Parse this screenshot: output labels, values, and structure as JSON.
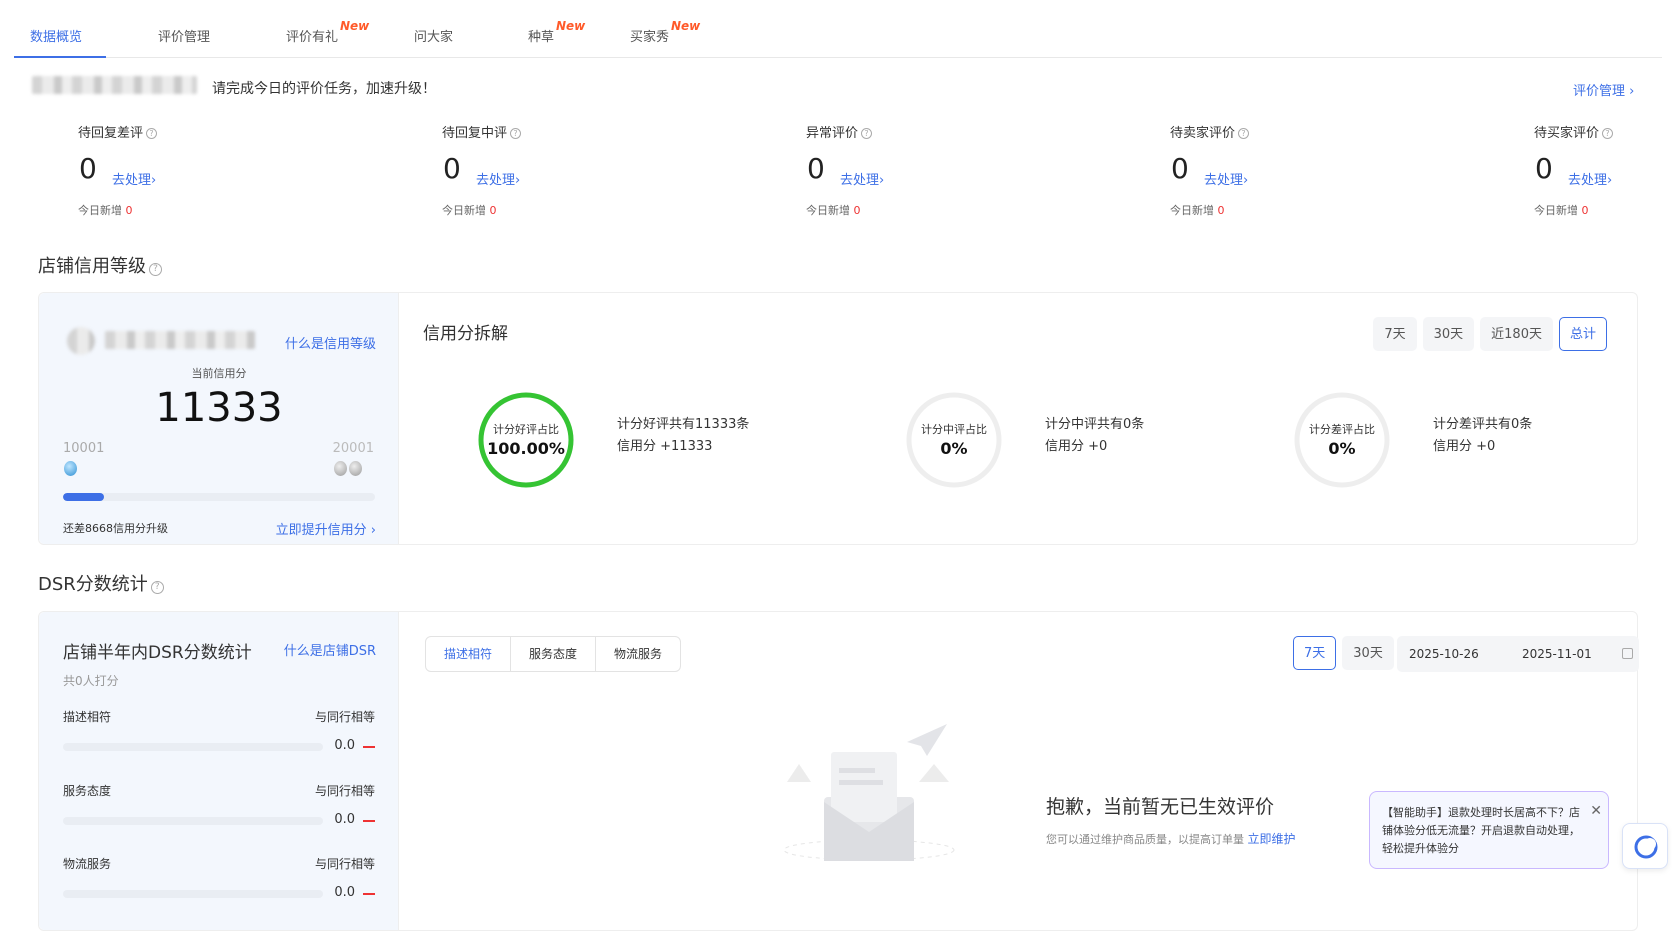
{
  "tabs": [
    {
      "label": "数据概览",
      "active": true
    },
    {
      "label": "评价管理"
    },
    {
      "label": "评价有礼",
      "badge": "New"
    },
    {
      "label": "问大家"
    },
    {
      "label": "种草",
      "badge": "New"
    },
    {
      "label": "买家秀",
      "badge": "New"
    }
  ],
  "banner": {
    "text": "请完成今日的评价任务，加速升级！",
    "link": "评价管理 ›"
  },
  "stats": [
    {
      "title": "待回复差评",
      "value": "0",
      "action": "去处理›",
      "today_label": "今日新增",
      "today_value": "0"
    },
    {
      "title": "待回复中评",
      "value": "0",
      "action": "去处理›",
      "today_label": "今日新增",
      "today_value": "0"
    },
    {
      "title": "异常评价",
      "value": "0",
      "action": "去处理›",
      "today_label": "今日新增",
      "today_value": "0"
    },
    {
      "title": "待卖家评价",
      "value": "0",
      "action": "去处理›",
      "today_label": "今日新增",
      "today_value": "0"
    },
    {
      "title": "待买家评价",
      "value": "0",
      "action": "去处理›",
      "today_label": "今日新增",
      "today_value": "0"
    }
  ],
  "credit": {
    "section_title": "店铺信用等级",
    "what_link": "什么是信用等级",
    "current_label": "当前信用分",
    "score": "11333",
    "level_min": "10001",
    "level_max": "20001",
    "progress_fraction": 0.13,
    "remaining_text": "还差8668信用分升级",
    "improve_link": "立即提升信用分 ›",
    "breakdown_title": "信用分拆解",
    "ranges": [
      {
        "label": "7天"
      },
      {
        "label": "30天"
      },
      {
        "label": "近180天"
      },
      {
        "label": "总计",
        "active": true
      }
    ],
    "rings": [
      {
        "label": "计分好评占比",
        "value": "100.00%",
        "fraction": 1.0,
        "color": "#35c433",
        "desc1": "计分好评共有11333条",
        "desc2": "信用分 +11333"
      },
      {
        "label": "计分中评占比",
        "value": "0%",
        "fraction": 0.0,
        "color": "#35c433",
        "desc1": "计分中评共有0条",
        "desc2": "信用分 +0"
      },
      {
        "label": "计分差评占比",
        "value": "0%",
        "fraction": 0.0,
        "color": "#35c433",
        "desc1": "计分差评共有0条",
        "desc2": "信用分 +0"
      }
    ]
  },
  "dsr": {
    "section_title": "DSR分数统计",
    "card_title": "店铺半年内DSR分数统计",
    "what_link": "什么是店铺DSR",
    "raters": "共0人打分",
    "metrics": [
      {
        "name": "描述相符",
        "compare": "与同行相等",
        "value": "0.0"
      },
      {
        "name": "服务态度",
        "compare": "与同行相等",
        "value": "0.0"
      },
      {
        "name": "物流服务",
        "compare": "与同行相等",
        "value": "0.0"
      }
    ],
    "segments": [
      {
        "label": "描述相符",
        "active": true
      },
      {
        "label": "服务态度"
      },
      {
        "label": "物流服务"
      }
    ],
    "ranges": [
      {
        "label": "7天",
        "active": true
      },
      {
        "label": "30天"
      }
    ],
    "date_start": "2025-10-26",
    "date_end": "2025-11-01",
    "empty_title": "抱歉，当前暂无已生效评价",
    "empty_sub": "您可以通过维护商品质量，以提高订单量",
    "empty_link": "立即维护"
  },
  "assistant": {
    "text": "【智能助手】退款处理时长居高不下？店铺体验分低无流量？开启退款自动处理，轻松提升体验分",
    "close": "✕"
  },
  "colors": {
    "accent": "#3d6fe6",
    "good": "#35c433",
    "alert": "#ee3333",
    "new_badge": "#ff5a2a"
  }
}
